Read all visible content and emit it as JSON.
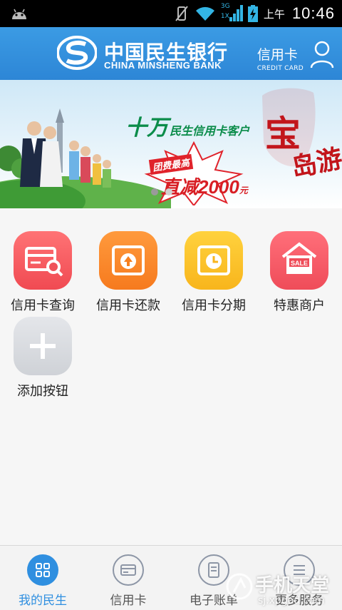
{
  "status_bar": {
    "ampm": "上午",
    "time": "10:46",
    "network_type": "3G",
    "data_indicator": "1X"
  },
  "header": {
    "brand_cn": "中国民生银行",
    "brand_en": "CHINA MINSHENG BANK",
    "section_cn": "信用卡",
    "section_en": "CREDIT CARD"
  },
  "banner": {
    "slogan": "十万",
    "slogan_rest": "民生信用卡客户",
    "stamp_1": "宝",
    "stamp_2": "岛游",
    "promo_line1": "团费最高",
    "promo_line2": "直减2000",
    "promo_unit": "元",
    "page_count": 2,
    "active_page": 0
  },
  "grid": {
    "items": [
      {
        "label": "信用卡查询",
        "icon": "card-search-icon",
        "color": "#f25d63"
      },
      {
        "label": "信用卡还款",
        "icon": "repay-upload-icon",
        "color": "#f8852a"
      },
      {
        "label": "信用卡分期",
        "icon": "installment-clock-icon",
        "color": "#f9c02a"
      },
      {
        "label": "特惠商户",
        "icon": "sale-shop-icon",
        "color": "#f45a66"
      },
      {
        "label": "添加按钮",
        "icon": "plus-icon",
        "color": "#d8dbe0"
      }
    ]
  },
  "bottom_nav": {
    "items": [
      {
        "label": "我的民生",
        "icon": "grid-icon",
        "active": true
      },
      {
        "label": "信用卡",
        "icon": "card-icon",
        "active": false
      },
      {
        "label": "电子账单",
        "icon": "bill-icon",
        "active": false
      },
      {
        "label": "更多服务",
        "icon": "menu-icon",
        "active": false
      }
    ]
  },
  "watermark": {
    "line1": "手机天堂",
    "line2": "sj.xpgod.com"
  },
  "colors": {
    "header_blue": "#3291dd",
    "accent_blue": "#2f8fe0"
  }
}
